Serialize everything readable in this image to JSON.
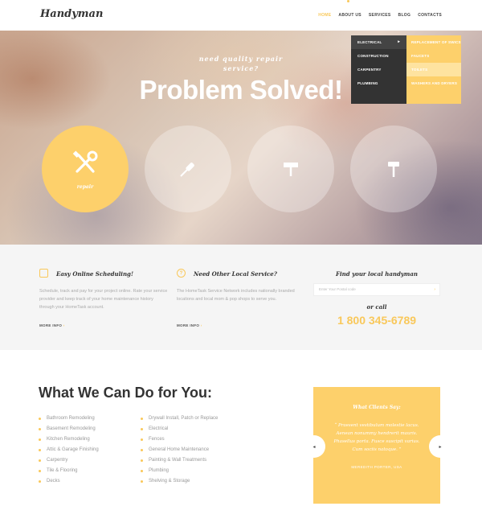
{
  "header": {
    "logo": "Handyman",
    "nav": [
      "HOME",
      "ABOUT US",
      "SERVICES",
      "BLOG",
      "CONTACTS"
    ]
  },
  "dropdown": {
    "main": [
      "ELECTRICAL",
      "CONSTRUCTION",
      "CARPENTRY",
      "PLUMBING"
    ],
    "sub": [
      "REPLACEMENT OF SWICS",
      "FAUCETS",
      "TOILETS",
      "WASHERS AND DRYERS"
    ]
  },
  "hero": {
    "subtitle_line1": "need quality repair",
    "subtitle_line2": "service?",
    "title": "Problem Solved!",
    "circle1_label": "repair"
  },
  "info": {
    "block1": {
      "title": "Easy Online Scheduling!",
      "text": "Schedule, track and pay for your project online. Rate your service provider and keep track of your home maintenance history through your HomeTask account.",
      "more": "MORE INFO"
    },
    "block2": {
      "title": "Need Other Local Service?",
      "text": "The HomeTask Service Network includes nationally branded locations and local mom & pop shops to serve you.",
      "more": "MORE INFO"
    },
    "finder": {
      "title": "Find your local handyman",
      "placeholder": "Enter Your Postal code",
      "or_call": "or call",
      "phone": "1 800 345-6789"
    }
  },
  "services": {
    "title": "What We Can Do for You:",
    "col1": [
      "Bathroom Remodeling",
      "Basement Remodeling",
      "Kitchen Remodeling",
      "Attic & Garage Finishing",
      "Carpentry",
      "Tile & Flooring",
      "Decks"
    ],
    "col2": [
      "Drywall Install, Patch or Replace",
      "Electrical",
      "Fences",
      "General Home Maintenance",
      "Painting & Wall Treatments",
      "Plumbing",
      "Shelving & Storage"
    ]
  },
  "testimonial": {
    "heading": "What Clients Say:",
    "quote": "“ Praesent vestibulum molestie lacus. Aenean nonummy hendrerit mauris. Phasellus porta. Fusce suscipit varius. Cum sociis natoque. ”",
    "author": "MEREDITH PORTER, USA"
  },
  "colors": {
    "accent": "#fdd06b",
    "dark": "#333333"
  }
}
